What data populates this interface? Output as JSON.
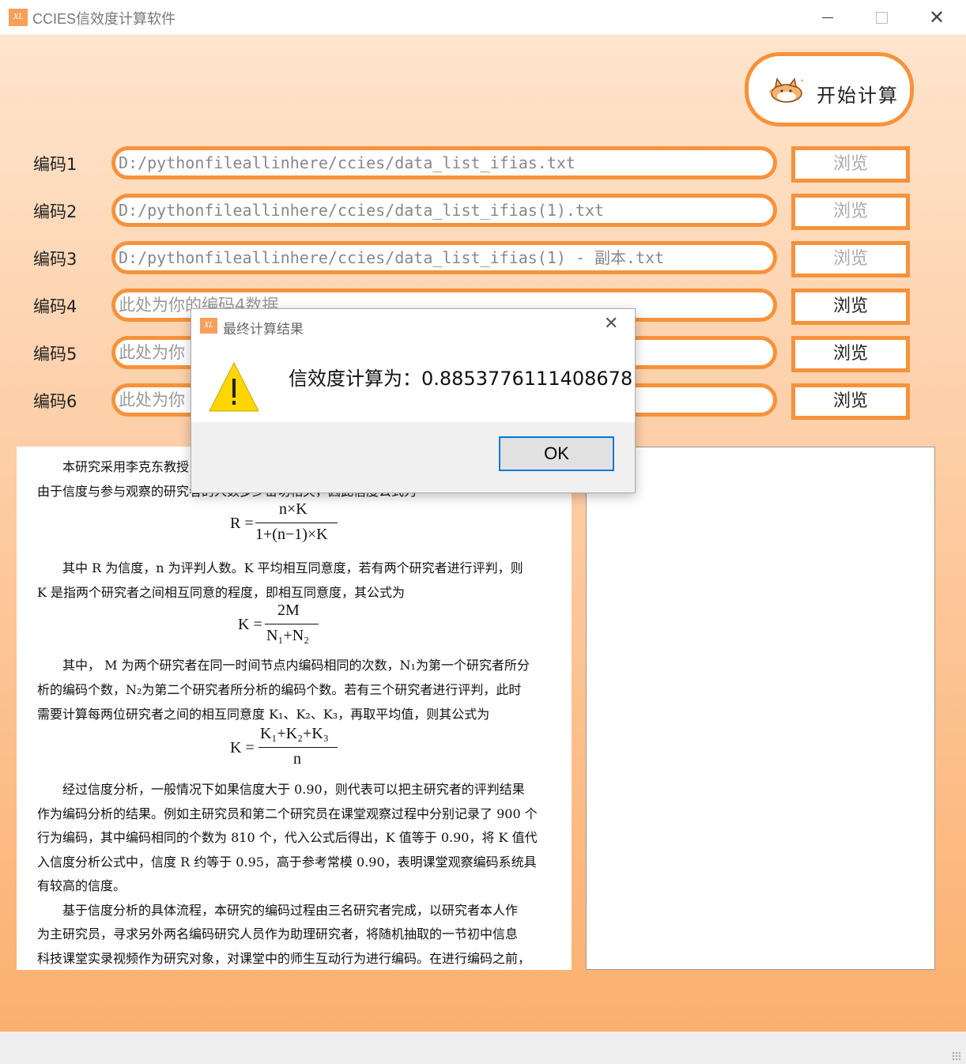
{
  "window": {
    "title": "CCIES信效度计算软件",
    "app_icon_text": "XL",
    "close_glyph": "✕"
  },
  "start_button": {
    "label": "开始计算"
  },
  "rows": [
    {
      "label": "编码1",
      "value": "D:/pythonfileallinhere/ccies/data_list_ifias.txt",
      "browse": "浏览"
    },
    {
      "label": "编码2",
      "value": "D:/pythonfileallinhere/ccies/data_list_ifias(1).txt",
      "browse": "浏览"
    },
    {
      "label": "编码3",
      "value": "D:/pythonfileallinhere/ccies/data_list_ifias(1) - 副本.txt",
      "browse": "浏览"
    },
    {
      "label": "编码4",
      "value": "此处为你的编码4数据.",
      "browse": "浏览"
    },
    {
      "label": "编码5",
      "value": "此处为你",
      "browse": "浏览"
    },
    {
      "label": "编码6",
      "value": "此处为你",
      "browse": "浏览"
    }
  ],
  "document": {
    "lines": [
      "本研究采用李克东教授",
      "由于信度与参与观察的研究者的人数多少密切相关，因此信度公式为",
      "其中 R 为信度，n 为评判人数。K 平均相互同意度，若有两个研究者进行评判，则",
      "K 是指两个研究者之间相互同意的程度，即相互同意度，其公式为",
      "其中， M 为两个研究者在同一时间节点内编码相同的次数，N₁为第一个研究者所分",
      "析的编码个数，N₂为第二个研究者所分析的编码个数。若有三个研究者进行评判，此时",
      "需要计算每两位研究者之间的相互同意度 K₁、K₂、K₃，再取平均值，则其公式为",
      "经过信度分析，一般情况下如果信度大于 0.90，则代表可以把主研究者的评判结果",
      "作为编码分析的结果。例如主研究员和第二个研究员在课堂观察过程中分别记录了 900 个",
      "行为编码，其中编码相同的个数为 810 个，代入公式后得出，K 值等于 0.90，将 K 值代",
      "入信度分析公式中，信度 R 约等于 0.95，高于参考常模 0.90，表明课堂观察编码系统具",
      "有较高的信度。",
      "基于信度分析的具体流程，本研究的编码过程由三名研究者完成，以研究者本人作",
      "为主研究员，寻求另外两名编码研究人员作为助理研究者，将随机抽取的一节初中信息",
      "科技课堂实录视频作为研究对象，对课堂中的师生互动行为进行编码。在进行编码之前，"
    ],
    "formula1": {
      "lhs": "R =",
      "num": "n×K",
      "den": "1+(n−1)×K"
    },
    "formula2": {
      "lhs": "K =",
      "num": "2M",
      "den": "N₁+N₂"
    },
    "formula3": {
      "lhs": "K =",
      "num": "K₁+K₂+K₃",
      "den": "n"
    }
  },
  "dialog": {
    "title": "最终计算结果",
    "message": "信效度计算为：0.8853776111408678",
    "ok_label": "OK",
    "icon": "warning-icon",
    "close_glyph": "✕"
  },
  "colors": {
    "accent": "#f7923b",
    "warning": "#ffd600"
  }
}
